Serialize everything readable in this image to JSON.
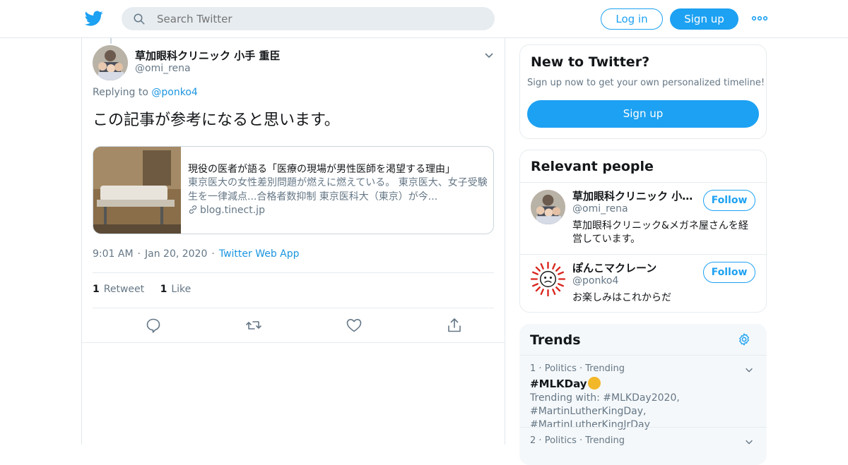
{
  "header": {
    "search_placeholder": "Search Twitter",
    "login_label": "Log in",
    "signup_label": "Sign up",
    "brand_color": "#1da1f2"
  },
  "tweet": {
    "author_name": "草加眼科クリニック 小手 重臣",
    "author_handle": "@omi_rena",
    "replying_prefix": "Replying to",
    "replying_to": "@ponko4",
    "text": "この記事が参考になると思います。",
    "card": {
      "title": "現役の医者が語る「医療の現場が男性医師を渇望する理由」",
      "description": "東京医大の女性差別問題が燃えに燃えている。 東京医大、女子受験生を一律減点...合格者数抑制 東京医科大（東京）が今...",
      "domain": "blog.tinect.jp"
    },
    "time": "9:01 AM",
    "date": "Jan 20, 2020",
    "source_app": "Twitter Web App",
    "retweet_count": "1",
    "retweet_label": "Retweet",
    "like_count": "1",
    "like_label": "Like"
  },
  "sidebar": {
    "new_to_twitter": {
      "title": "New to Twitter?",
      "subtitle": "Sign up now to get your own personalized timeline!",
      "button_label": "Sign up"
    },
    "relevant_people": {
      "title": "Relevant people",
      "people": [
        {
          "name": "草加眼科クリニック 小手 重臣",
          "handle": "@omi_rena",
          "bio": "草加眼科クリニック&メガネ屋さんを経営しています。",
          "follow_label": "Follow"
        },
        {
          "name": "ぽんこマクレーン",
          "handle": "@ponko4",
          "bio": "お楽しみはこれからだ",
          "follow_label": "Follow"
        }
      ]
    },
    "trends": {
      "title": "Trends",
      "items": [
        {
          "rank": "1",
          "category": "Politics",
          "status": "Trending",
          "name": "#MLKDay",
          "trending_with": "Trending with: #MLKDay2020, #MartinLutherKingDay, #MartinLutherKingJrDay"
        },
        {
          "rank": "2",
          "category": "Politics",
          "status": "Trending"
        }
      ]
    }
  }
}
